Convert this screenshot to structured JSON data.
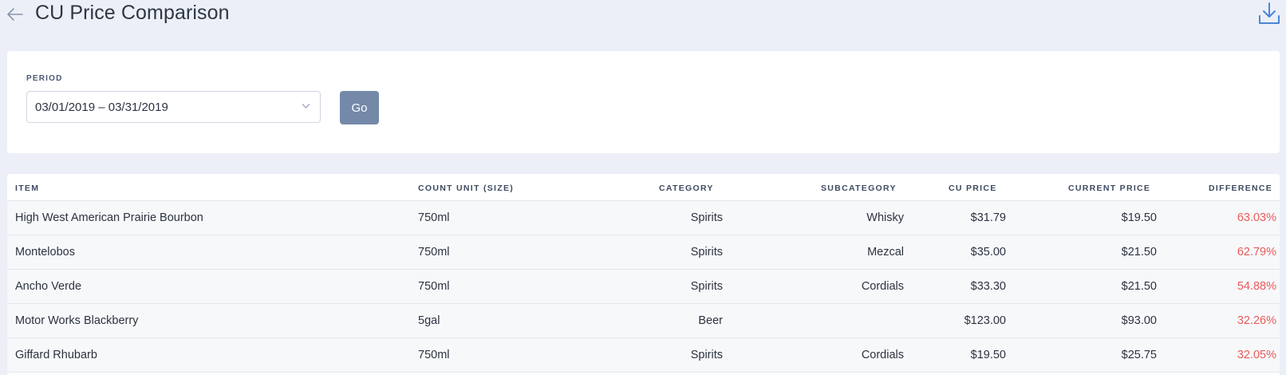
{
  "header": {
    "title": "CU Price Comparison",
    "back_icon": "arrow-left-icon",
    "download_icon": "download-icon"
  },
  "filter": {
    "period_label": "PERIOD",
    "period_value": "03/01/2019 – 03/31/2019",
    "go_label": "Go"
  },
  "colors": {
    "background": "#eceff7",
    "accent": "#7489a8",
    "negative": "#ea5a5a",
    "icon_blue": "#4a86d8"
  },
  "table": {
    "columns": {
      "item": "ITEM",
      "count_unit": "COUNT UNIT (SIZE)",
      "category": "CATEGORY",
      "subcategory": "SUBCATEGORY",
      "cu_price": "CU PRICE",
      "current_price": "CURRENT PRICE",
      "difference": "DIFFERENCE"
    },
    "rows": [
      {
        "item": "High West American Prairie Bourbon",
        "count_unit": "750ml",
        "category": "Spirits",
        "subcategory": "Whisky",
        "cu_price": "$31.79",
        "current_price": "$19.50",
        "difference": "63.03%"
      },
      {
        "item": "Montelobos",
        "count_unit": "750ml",
        "category": "Spirits",
        "subcategory": "Mezcal",
        "cu_price": "$35.00",
        "current_price": "$21.50",
        "difference": "62.79%"
      },
      {
        "item": "Ancho Verde",
        "count_unit": "750ml",
        "category": "Spirits",
        "subcategory": "Cordials",
        "cu_price": "$33.30",
        "current_price": "$21.50",
        "difference": "54.88%"
      },
      {
        "item": "Motor Works Blackberry",
        "count_unit": "5gal",
        "category": "Beer",
        "subcategory": "",
        "cu_price": "$123.00",
        "current_price": "$93.00",
        "difference": "32.26%"
      },
      {
        "item": "Giffard Rhubarb",
        "count_unit": "750ml",
        "category": "Spirits",
        "subcategory": "Cordials",
        "cu_price": "$19.50",
        "current_price": "$25.75",
        "difference": "32.05%"
      }
    ]
  }
}
